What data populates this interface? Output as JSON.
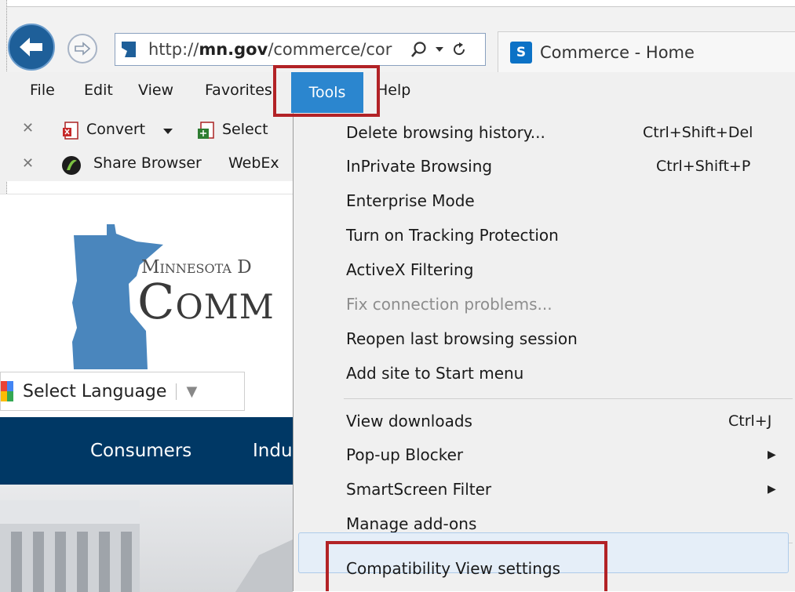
{
  "browser": {
    "url_prefix": "http://",
    "url_domain": "mn.gov",
    "url_path": "/commerce/cor",
    "tab_title": "Commerce - Home",
    "icons": [
      "back-arrow-icon",
      "forward-arrow-icon",
      "search-icon",
      "dropdown-caret-icon",
      "refresh-icon",
      "sharepoint-icon"
    ]
  },
  "menubar": {
    "file": "File",
    "edit": "Edit",
    "view": "View",
    "favorites": "Favorites",
    "tools": "Tools",
    "help": "Help"
  },
  "toolbar1": {
    "convert": "Convert",
    "select": "Select"
  },
  "toolbar2": {
    "share": "Share Browser",
    "webex": "WebEx"
  },
  "page": {
    "logo_line1": "Minnesota D",
    "logo_line2": "Comm",
    "language": "Select Language",
    "nav": [
      "Consumers",
      "Indu"
    ]
  },
  "tools_menu": {
    "items": [
      {
        "label": "Delete browsing history...",
        "shortcut": "Ctrl+Shift+Del"
      },
      {
        "label": "InPrivate Browsing",
        "shortcut": "Ctrl+Shift+P"
      },
      {
        "label": "Enterprise Mode"
      },
      {
        "label": "Turn on Tracking Protection"
      },
      {
        "label": "ActiveX Filtering"
      },
      {
        "label": "Fix connection problems...",
        "disabled": true
      },
      {
        "label": "Reopen last browsing session"
      },
      {
        "label": "Add site to Start menu"
      },
      {
        "label": "View downloads",
        "shortcut": "Ctrl+J"
      },
      {
        "label": "Pop-up Blocker",
        "submenu": true
      },
      {
        "label": "SmartScreen Filter",
        "submenu": true
      },
      {
        "label": "Manage add-ons"
      },
      {
        "label": "Compatibility View settings",
        "highlighted": true
      }
    ]
  },
  "colors": {
    "highlight_red": "#b22226",
    "menu_active": "#2b86cf",
    "nav_band": "#003865",
    "logo_blue": "#4a86bd"
  }
}
